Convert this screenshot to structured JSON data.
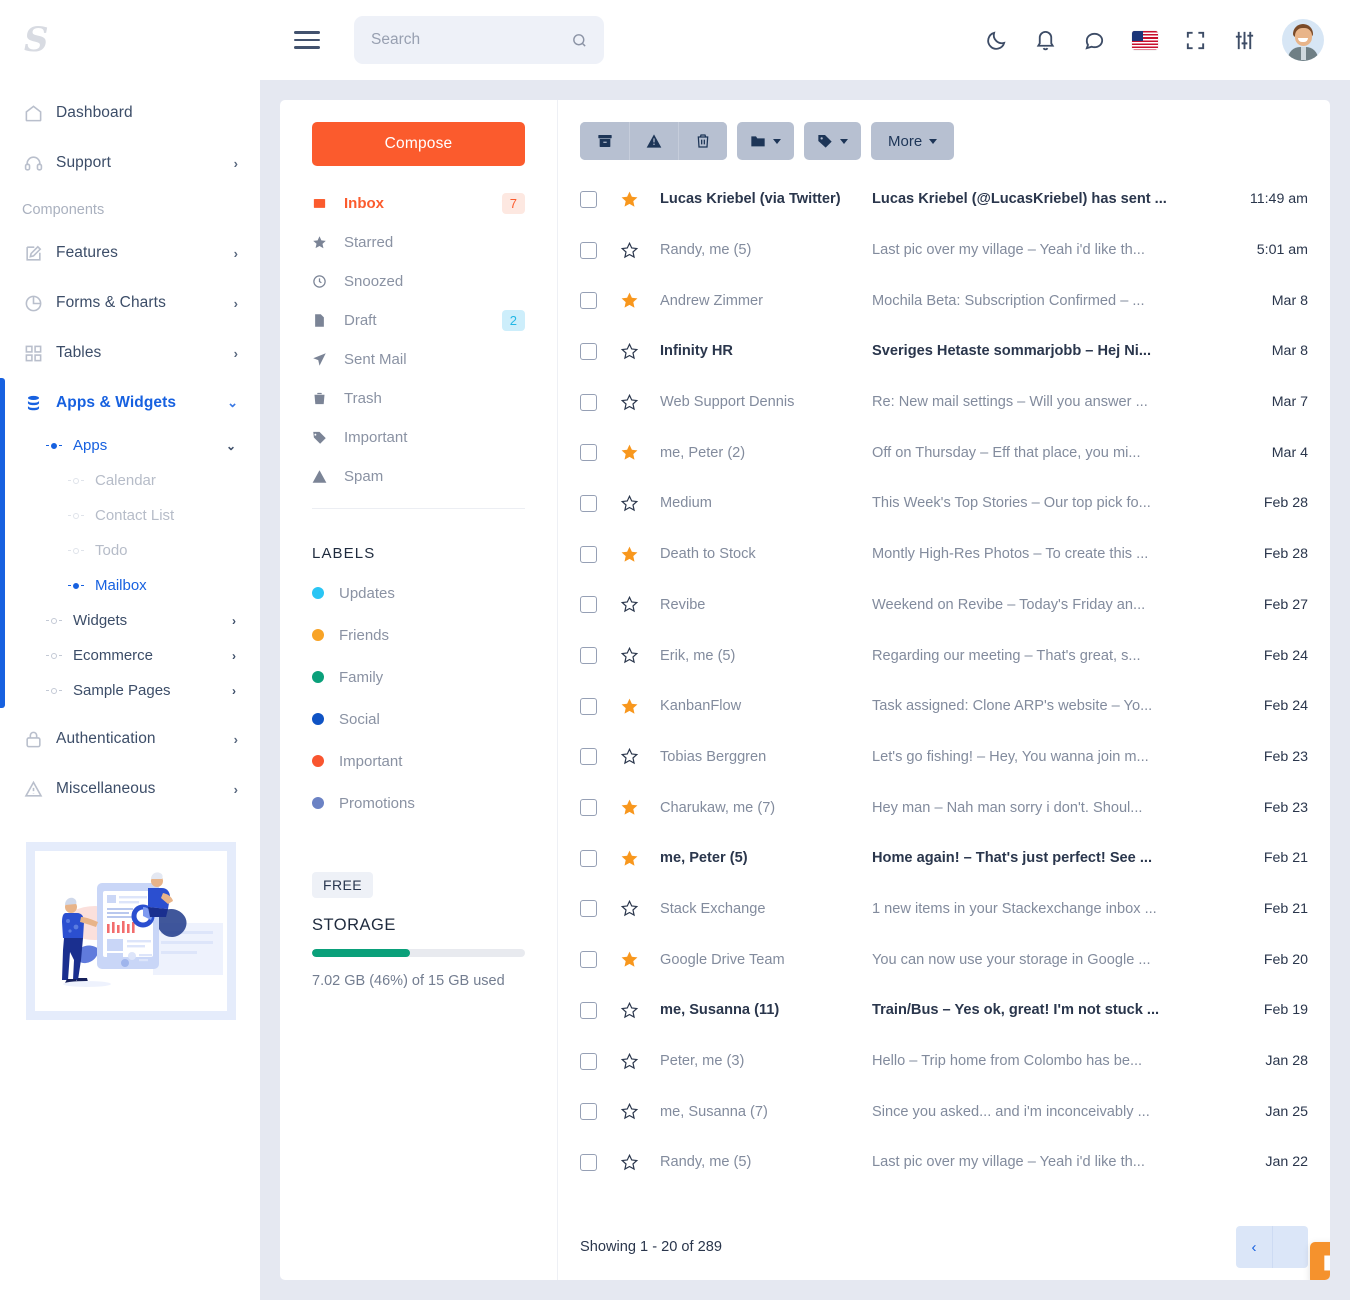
{
  "brand": {
    "logo_text": "S"
  },
  "topbar": {
    "menu_icon": "hamburger-icon",
    "search": {
      "placeholder": "Search",
      "value": ""
    },
    "icons": [
      "moon-icon",
      "bell-icon",
      "chat-icon",
      "flag-us-icon",
      "fullscreen-icon",
      "sliders-icon",
      "avatar"
    ]
  },
  "sidebar": {
    "section_label": "Components",
    "items": [
      {
        "label": "Dashboard",
        "icon": "home-icon",
        "chevron": false
      },
      {
        "label": "Support",
        "icon": "headset-icon",
        "chevron": true
      },
      {
        "label": "Features",
        "icon": "edit-square-icon",
        "chevron": true
      },
      {
        "label": "Forms & Charts",
        "icon": "pie-chart-icon",
        "chevron": true
      },
      {
        "label": "Tables",
        "icon": "grid-icon",
        "chevron": true
      },
      {
        "label": "Apps & Widgets",
        "icon": "database-icon",
        "chevron": true,
        "active": true
      },
      {
        "label": "Authentication",
        "icon": "lock-icon",
        "chevron": true
      },
      {
        "label": "Miscellaneous",
        "icon": "warning-triangle-icon",
        "chevron": true
      }
    ],
    "apps_group": {
      "label": "Apps"
    },
    "apps_children": [
      {
        "label": "Calendar",
        "state": "muted"
      },
      {
        "label": "Contact List",
        "state": "muted"
      },
      {
        "label": "Todo",
        "state": "muted"
      },
      {
        "label": "Mailbox",
        "state": "selected"
      }
    ],
    "apps_siblings": [
      {
        "label": "Widgets",
        "chevron": true
      },
      {
        "label": "Ecommerce",
        "chevron": true
      },
      {
        "label": "Sample Pages",
        "chevron": true
      }
    ],
    "promo_alt": "dashboard-illustration"
  },
  "mailnav": {
    "compose_label": "Compose",
    "folders": [
      {
        "label": "Inbox",
        "icon": "inbox-icon",
        "badge": "7",
        "badge_type": "warn",
        "selected": true
      },
      {
        "label": "Starred",
        "icon": "star-icon",
        "badge": "",
        "badge_type": ""
      },
      {
        "label": "Snoozed",
        "icon": "clock-icon",
        "badge": "",
        "badge_type": ""
      },
      {
        "label": "Draft",
        "icon": "file-icon",
        "badge": "2",
        "badge_type": "info"
      },
      {
        "label": "Sent Mail",
        "icon": "send-icon",
        "badge": "",
        "badge_type": ""
      },
      {
        "label": "Trash",
        "icon": "trash-icon",
        "badge": "",
        "badge_type": ""
      },
      {
        "label": "Important",
        "icon": "tag-icon",
        "badge": "",
        "badge_type": ""
      },
      {
        "label": "Spam",
        "icon": "warning-triangle-icon",
        "badge": "",
        "badge_type": ""
      }
    ],
    "labels_title": "LABELS",
    "labels": [
      {
        "label": "Updates",
        "color": "#2ac5f4"
      },
      {
        "label": "Friends",
        "color": "#f8a326"
      },
      {
        "label": "Family",
        "color": "#0aa07a"
      },
      {
        "label": "Social",
        "color": "#0f53c4"
      },
      {
        "label": "Important",
        "color": "#f9552f"
      },
      {
        "label": "Promotions",
        "color": "#6b82c4"
      }
    ],
    "plan_tag": "FREE",
    "storage_title": "STORAGE",
    "storage_percent": 46,
    "storage_note": "7.02 GB (46%) of 15 GB used"
  },
  "mailtoolbar": {
    "archive_label": "",
    "spam_label": "",
    "delete_label": "",
    "folder_label": "",
    "tag_label": "",
    "more_label": "More"
  },
  "mails": [
    {
      "sender": "Lucas Kriebel (via Twitter)",
      "subject": "Lucas Kriebel (@LucasKriebel) has sent ...",
      "preview": "",
      "time": "11:49 am",
      "starred": true,
      "unread": true
    },
    {
      "sender": "Randy, me (5)",
      "subject": "Last pic over my village",
      "preview": "Yeah i'd like th...",
      "time": "5:01 am",
      "starred": false,
      "unread": false
    },
    {
      "sender": "Andrew Zimmer",
      "subject": "Mochila Beta: Subscription Confirmed",
      "preview": "...",
      "time": "Mar 8",
      "starred": true,
      "unread": false
    },
    {
      "sender": "Infinity HR",
      "subject": "Sveriges Hetaste sommarjobb",
      "preview": "Hej Ni...",
      "time": "Mar 8",
      "starred": false,
      "unread": true
    },
    {
      "sender": "Web Support Dennis",
      "subject": "Re: New mail settings",
      "preview": "Will you answer ...",
      "time": "Mar 7",
      "starred": false,
      "unread": false
    },
    {
      "sender": "me, Peter (2)",
      "subject": "Off on Thursday",
      "preview": "Eff that place, you mi...",
      "time": "Mar 4",
      "starred": true,
      "unread": false
    },
    {
      "sender": "Medium",
      "subject": "This Week's Top Stories",
      "preview": "Our top pick fo...",
      "time": "Feb 28",
      "starred": false,
      "unread": false
    },
    {
      "sender": "Death to Stock",
      "subject": "Montly High-Res Photos",
      "preview": "To create this ...",
      "time": "Feb 28",
      "starred": true,
      "unread": false
    },
    {
      "sender": "Revibe",
      "subject": "Weekend on Revibe",
      "preview": "Today's Friday an...",
      "time": "Feb 27",
      "starred": false,
      "unread": false
    },
    {
      "sender": "Erik, me (5)",
      "subject": "Regarding our meeting",
      "preview": "That's great, s...",
      "time": "Feb 24",
      "starred": false,
      "unread": false
    },
    {
      "sender": "KanbanFlow",
      "subject": "Task assigned: Clone ARP's website",
      "preview": "Yo...",
      "time": "Feb 24",
      "starred": true,
      "unread": false
    },
    {
      "sender": "Tobias Berggren",
      "subject": "Let's go fishing!",
      "preview": "Hey, You wanna join m...",
      "time": "Feb 23",
      "starred": false,
      "unread": false
    },
    {
      "sender": "Charukaw, me (7)",
      "subject": "Hey man",
      "preview": "Nah man sorry i don't. Shoul...",
      "time": "Feb 23",
      "starred": true,
      "unread": false
    },
    {
      "sender": "me, Peter (5)",
      "subject": "Home again!",
      "preview": "That's just perfect! See ...",
      "time": "Feb 21",
      "starred": true,
      "unread": true
    },
    {
      "sender": "Stack Exchange",
      "subject": "1 new items in your Stackexchange inbox ...",
      "preview": "",
      "time": "Feb 21",
      "starred": false,
      "unread": false
    },
    {
      "sender": "Google Drive Team",
      "subject": "You can now use your storage in Google ...",
      "preview": "",
      "time": "Feb 20",
      "starred": true,
      "unread": false
    },
    {
      "sender": "me, Susanna (11)",
      "subject": "Train/Bus",
      "preview": "Yes ok, great! I'm not stuck ...",
      "time": "Feb 19",
      "starred": false,
      "unread": true
    },
    {
      "sender": "Peter, me (3)",
      "subject": "Hello",
      "preview": "Trip home from Colombo has be...",
      "time": "Jan 28",
      "starred": false,
      "unread": false
    },
    {
      "sender": "me, Susanna (7)",
      "subject": "Since you asked... and i'm inconceivably ...",
      "preview": "",
      "time": "Jan 25",
      "starred": false,
      "unread": false
    },
    {
      "sender": "Randy, me (5)",
      "subject": "Last pic over my village",
      "preview": "Yeah i'd like th...",
      "time": "Jan 22",
      "starred": false,
      "unread": false
    }
  ],
  "footer": {
    "showing": "Showing 1 - 20 of 289",
    "prev_label": "‹",
    "next_label": ""
  },
  "colors": {
    "accent_orange": "#fb5b2d",
    "accent_blue": "#1761e0",
    "fab_orange": "#f5922d",
    "star_on": "#f8971d",
    "page_bg": "#e5e8f1"
  }
}
